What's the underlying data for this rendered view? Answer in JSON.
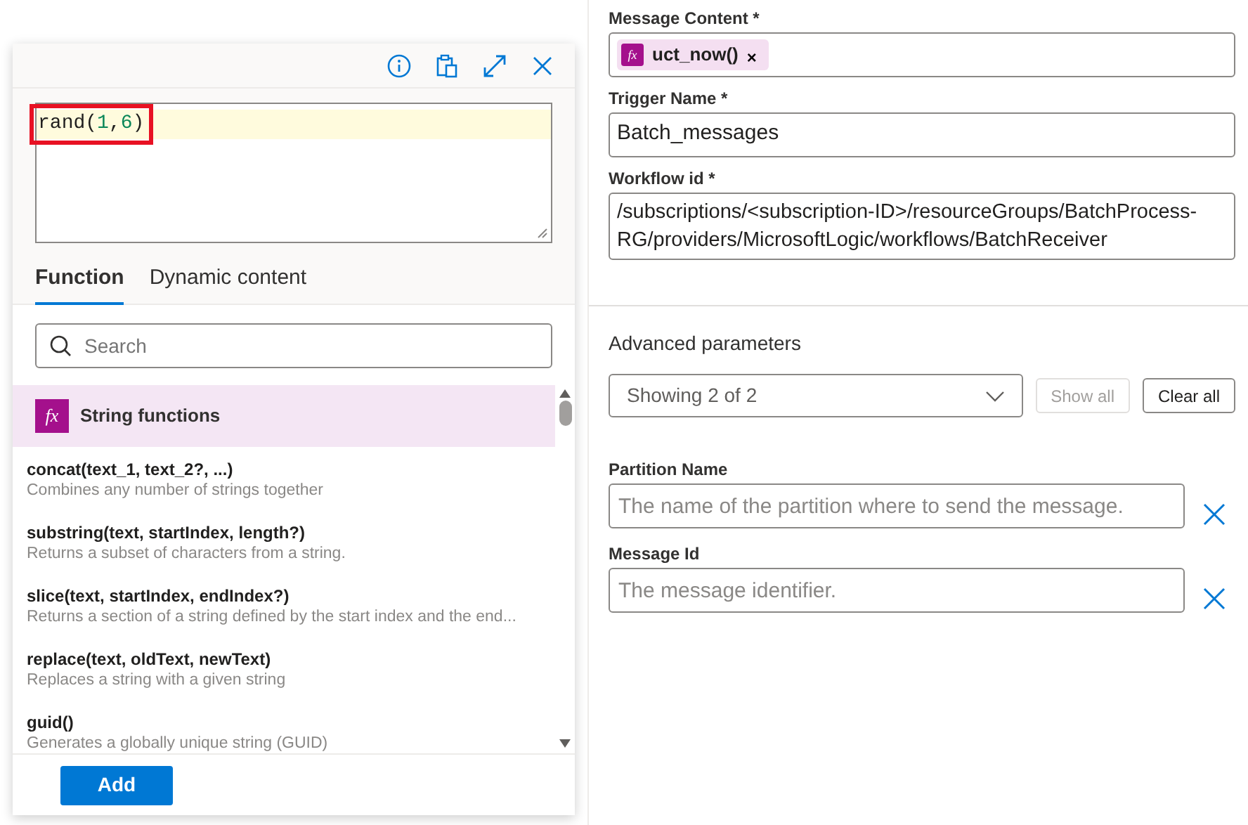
{
  "editor_panel": {
    "header_buttons": [
      {
        "kind": "info"
      },
      {
        "kind": "paste"
      },
      {
        "kind": "expand"
      },
      {
        "kind": "close"
      }
    ],
    "expression": "rand(1,6)",
    "expression_highlighted": true,
    "tabs": [
      {
        "label": "Function",
        "selected": true
      },
      {
        "label": "Dynamic content",
        "selected": false
      }
    ],
    "search": {
      "placeholder": "Search"
    },
    "group": {
      "icon_text": "fx",
      "label": "String functions"
    },
    "functions": [
      {
        "signature": "concat(text_1, text_2?, ...)",
        "description": "Combines any number of strings together"
      },
      {
        "signature": "substring(text, startIndex, length?)",
        "description": "Returns a subset of characters from a string."
      },
      {
        "signature": "slice(text, startIndex, endIndex?)",
        "description": "Returns a section of a string defined by the start index and the end..."
      },
      {
        "signature": "replace(text, oldText, newText)",
        "description": "Replaces a string with a given string"
      },
      {
        "signature": "guid()",
        "description": "Generates a globally unique string (GUID)"
      }
    ],
    "add_button": "Add"
  },
  "parameters": [
    {
      "label": "Message Content *",
      "kind": "token",
      "token": {
        "icon_text": "fx",
        "label": "uct_now()",
        "remove": "×"
      }
    },
    {
      "label": "Trigger Name *",
      "kind": "text",
      "value": "Batch_messages"
    },
    {
      "label": "Workflow id *",
      "kind": "multiline",
      "value": "/subscriptions/<subscription-ID>/resourceGroups/BatchProcess-RG/providers/MicrosoftLogic/workflows/BatchReceiver"
    }
  ],
  "advanced": {
    "title": "Advanced parameters",
    "dropdown": "Showing 2 of 2",
    "buttons": [
      {
        "label": "Show all",
        "disabled": true
      },
      {
        "label": "Clear all",
        "disabled": false
      }
    ],
    "fields": [
      {
        "label": "Partition Name",
        "placeholder": "The name of the partition where to send the message."
      },
      {
        "label": "Message Id",
        "placeholder": "The message identifier."
      }
    ]
  }
}
